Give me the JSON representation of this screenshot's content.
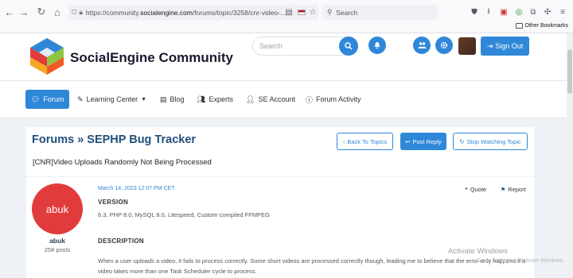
{
  "browser": {
    "url_prefix": "https://community.",
    "url_domain": "socialengine.com",
    "url_suffix": "/forums/topic/3258/cnr-video-...",
    "search_placeholder": "Search",
    "other_bookmarks": "Other Bookmarks"
  },
  "header": {
    "site_title": "SocialEngine Community",
    "search_placeholder": "Search",
    "signout_label": "Sign Out",
    "brand_colors": [
      "#e23b3b",
      "#f7a823",
      "#2f87d8",
      "#8cc63f"
    ]
  },
  "nav": {
    "items": [
      {
        "label": "Forum",
        "icon": "comments-icon"
      },
      {
        "label": "Learning Center",
        "icon": "pencil-icon"
      },
      {
        "label": "Blog",
        "icon": "newspaper-icon"
      },
      {
        "label": "Experts",
        "icon": "users-icon"
      },
      {
        "label": "SE Account",
        "icon": "user-secret-icon"
      },
      {
        "label": "Forum Activity",
        "icon": "info-icon"
      }
    ]
  },
  "topic": {
    "breadcrumb": "Forums » SEPHP Bug Tracker",
    "back_label": "Back To Topics",
    "reply_label": "Post Reply",
    "watch_label": "Stop Watching Topic",
    "title": "[CNR]Video Uploads Randomly Not Being Processed"
  },
  "post": {
    "author": "abuk",
    "avatar_text": "abuk",
    "posts_count": "258 posts",
    "date": "March 14, 2023 12:07 PM CET",
    "quote_label": "Quote",
    "report_label": "Report",
    "version_heading": "VERSION",
    "version_text": "6.3, PHP 8.0, MySQL 8.0, Litespeed, Custom compiled FFMPEG",
    "description_heading": "DESCRIPTION",
    "description_text": "When a user uploads a video, it fails to process correctly. Some short videos are processed correctly though, leading me to believe that the error only happens if a video takes more than one Task Scheduler cycle to process."
  },
  "overlay": {
    "activate_title": "Activate Windows",
    "activate_sub": "Go to Settings to activate Windows."
  }
}
